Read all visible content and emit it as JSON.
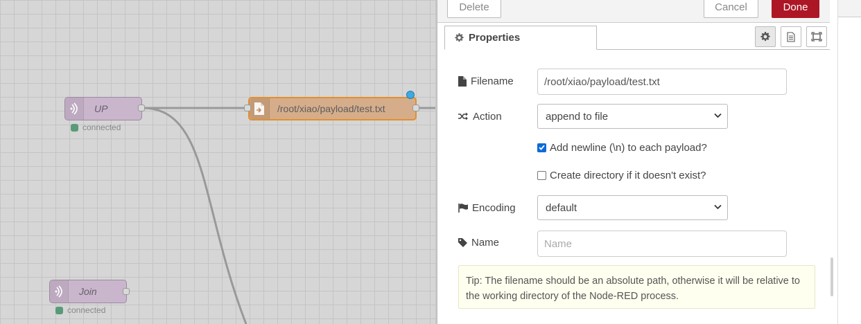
{
  "canvas": {
    "nodes": {
      "up": {
        "label": "UP",
        "status": "connected"
      },
      "join": {
        "label": "Join",
        "status": "connected"
      },
      "file": {
        "label": "/root/xiao/payload/test.txt"
      }
    },
    "colors": {
      "grid_bg": "#d6d6d6",
      "lora_node": "#c9b5cc",
      "file_node": "#d6ad8b",
      "file_border": "#e38f2e",
      "status_ok": "#5a9a79",
      "changed": "#3fa9e0"
    }
  },
  "tray": {
    "toolbar": {
      "delete_label": "Delete",
      "cancel_label": "Cancel",
      "done_label": "Done"
    },
    "tabs": {
      "properties_label": "Properties",
      "icons": [
        "gear-icon",
        "description-icon",
        "appearance-icon"
      ]
    },
    "form": {
      "filename": {
        "label": "Filename",
        "value": "/root/xiao/payload/test.txt"
      },
      "action": {
        "label": "Action",
        "value": "append to file"
      },
      "add_newline": {
        "label": "Add newline (\\n) to each payload?",
        "checked": true
      },
      "create_dir": {
        "label": "Create directory if it doesn't exist?",
        "checked": false
      },
      "encoding": {
        "label": "Encoding",
        "value": "default"
      },
      "name": {
        "label": "Name",
        "placeholder": "Name",
        "value": ""
      }
    },
    "tip": "Tip: The filename should be an absolute path, otherwise it will be relative to the working directory of the Node-RED process.",
    "colors": {
      "primary_button": "#ad1625",
      "checkbox_on": "#0a6cd6",
      "tip_bg": "#ffffef"
    }
  }
}
